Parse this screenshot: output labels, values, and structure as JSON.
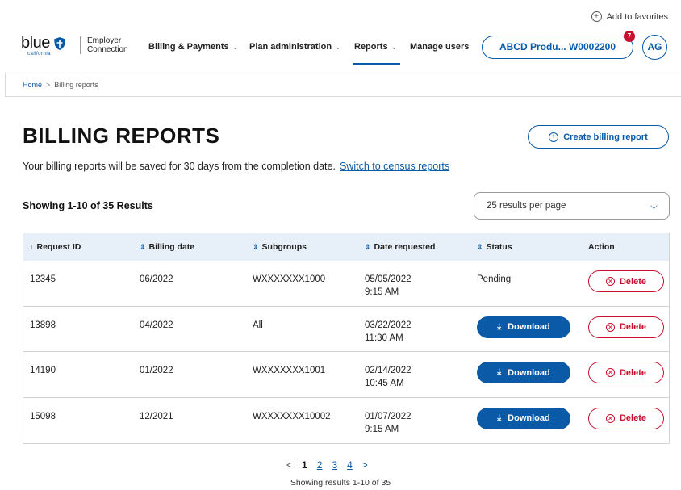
{
  "header": {
    "favorites_label": "Add to favorites",
    "favorites_icon": "plus-circle-icon",
    "logo_word": "blue",
    "logo_sub": "california",
    "portal_name_line1": "Employer",
    "portal_name_line2": "Connection",
    "nav": [
      {
        "label": "Billing & Payments",
        "has_menu": true
      },
      {
        "label": "Plan administration",
        "has_menu": true
      },
      {
        "label": "Reports",
        "has_menu": true,
        "active": true
      },
      {
        "label": "Manage users",
        "has_menu": false
      }
    ],
    "account_label": "ABCD Produ... W0002200",
    "account_badge": "7",
    "avatar_initials": "AG"
  },
  "breadcrumb": {
    "home": "Home",
    "separator": ">",
    "current": "Billing reports"
  },
  "page": {
    "title": "BILLING REPORTS",
    "create_button": "Create billing report",
    "subtext": "Your billing reports will be saved for 30 days from the completion date.",
    "switch_link": "Switch to census reports",
    "showing": "Showing 1-10 of 35 Results",
    "per_page": "25 results per page"
  },
  "table": {
    "columns": [
      "Request ID",
      "Billing date",
      "Subgroups",
      "Date requested",
      "Status",
      "Action"
    ],
    "rows": [
      {
        "id": "12345",
        "billing_date": "06/2022",
        "subgroups": "WXXXXXXX1000",
        "date": "05/05/2022",
        "time": "9:15 AM",
        "status": "Pending",
        "download": "",
        "delete": "Delete"
      },
      {
        "id": "13898",
        "billing_date": "04/2022",
        "subgroups": "All",
        "date": "03/22/2022",
        "time": "11:30 AM",
        "status": "",
        "download": "Download",
        "delete": "Delete"
      },
      {
        "id": "14190",
        "billing_date": "01/2022",
        "subgroups": "WXXXXXXX1001",
        "date": "02/14/2022",
        "time": "10:45 AM",
        "status": "",
        "download": "Download",
        "delete": "Delete"
      },
      {
        "id": "15098",
        "billing_date": "12/2021",
        "subgroups": "WXXXXXXX10002",
        "date": "01/07/2022",
        "time": "9:15 AM",
        "status": "",
        "download": "Download",
        "delete": "Delete"
      }
    ]
  },
  "pagination": {
    "prev": "<",
    "pages": [
      "1",
      "2",
      "3",
      "4"
    ],
    "current": "1",
    "next": ">",
    "summary": "Showing results 1-10 of 35"
  },
  "colors": {
    "brand_blue": "#0a5aa8",
    "danger_red": "#c8102e",
    "table_header_bg": "#e7f0f8"
  }
}
